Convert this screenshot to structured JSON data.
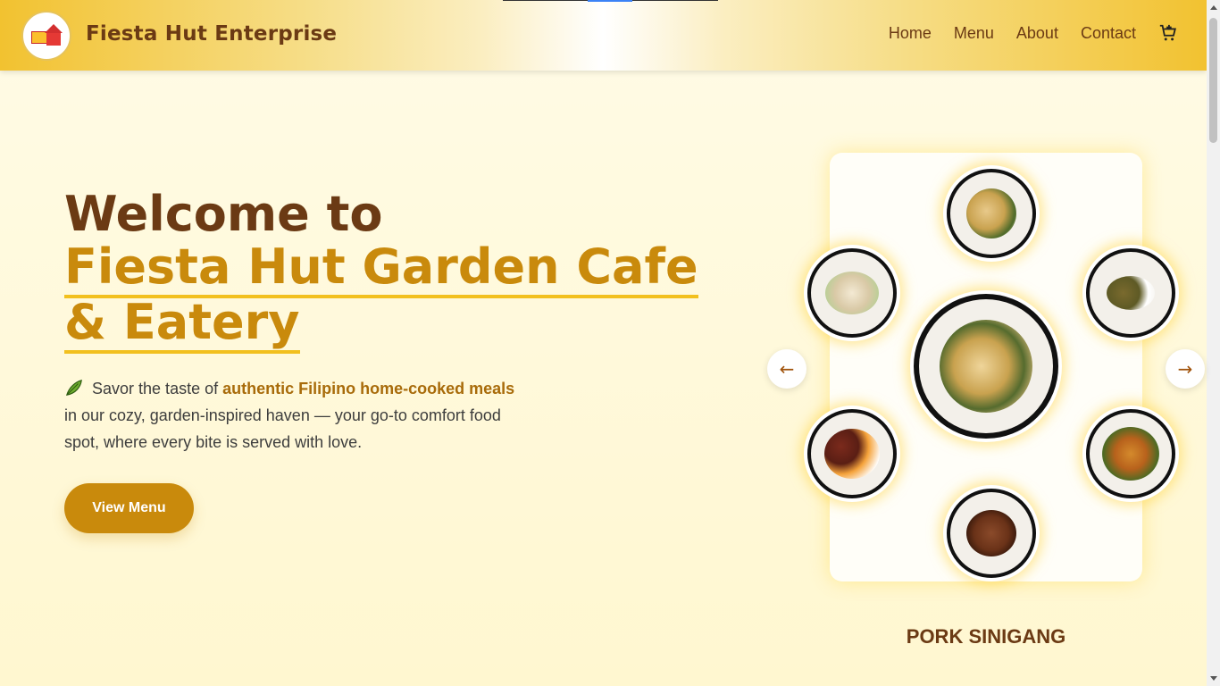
{
  "header": {
    "brand": "Fiesta Hut Enterprise",
    "logo_icon": "restaurant-house-logo",
    "nav": [
      "Home",
      "Menu",
      "About",
      "Contact"
    ],
    "cart_icon": "cart-icon"
  },
  "hero": {
    "title_line1": "Welcome to",
    "title_line2": "Fiesta Hut Garden Cafe & Eatery",
    "leaf_icon": "leaf-icon",
    "desc_before": "Savor the taste of",
    "desc_highlight": "authentic Filipino home-cooked meals",
    "desc_after": "in our cozy, garden-inspired haven — your go-to comfort food spot, where every bite is served with love.",
    "button_label": "View Menu"
  },
  "carousel": {
    "prev_label": "←",
    "next_label": "→",
    "current_dish": "PORK SINIGANG"
  },
  "colors": {
    "brown": "#6b3a14",
    "gold": "#c98a0c",
    "underline": "#f2c01e",
    "header_gold": "#f2c230"
  }
}
